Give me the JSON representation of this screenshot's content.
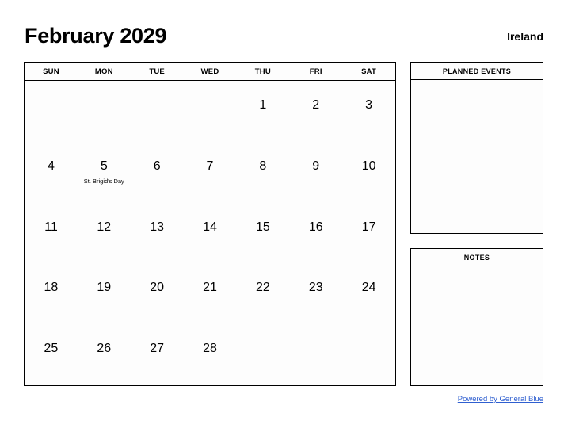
{
  "header": {
    "title": "February 2029",
    "region": "Ireland"
  },
  "calendar": {
    "weekdays": [
      "SUN",
      "MON",
      "TUE",
      "WED",
      "THU",
      "FRI",
      "SAT"
    ],
    "weeks": [
      [
        {
          "day": ""
        },
        {
          "day": ""
        },
        {
          "day": ""
        },
        {
          "day": ""
        },
        {
          "day": "1"
        },
        {
          "day": "2"
        },
        {
          "day": "3"
        }
      ],
      [
        {
          "day": "4"
        },
        {
          "day": "5",
          "event": "St. Brigid's Day"
        },
        {
          "day": "6"
        },
        {
          "day": "7"
        },
        {
          "day": "8"
        },
        {
          "day": "9"
        },
        {
          "day": "10"
        }
      ],
      [
        {
          "day": "11"
        },
        {
          "day": "12"
        },
        {
          "day": "13"
        },
        {
          "day": "14"
        },
        {
          "day": "15"
        },
        {
          "day": "16"
        },
        {
          "day": "17"
        }
      ],
      [
        {
          "day": "18"
        },
        {
          "day": "19"
        },
        {
          "day": "20"
        },
        {
          "day": "21"
        },
        {
          "day": "22"
        },
        {
          "day": "23"
        },
        {
          "day": "24"
        }
      ],
      [
        {
          "day": "25"
        },
        {
          "day": "26"
        },
        {
          "day": "27"
        },
        {
          "day": "28"
        },
        {
          "day": ""
        },
        {
          "day": ""
        },
        {
          "day": ""
        }
      ]
    ]
  },
  "sidebar": {
    "planned_events": {
      "title": "PLANNED EVENTS",
      "content": ""
    },
    "notes": {
      "title": "NOTES",
      "content": ""
    }
  },
  "footer": {
    "link_text": "Powered by General Blue"
  },
  "colors": {
    "link": "#2f5fd0",
    "border": "#000000",
    "page_background": "#ffffff",
    "cell_background": "#fdfdfd"
  }
}
